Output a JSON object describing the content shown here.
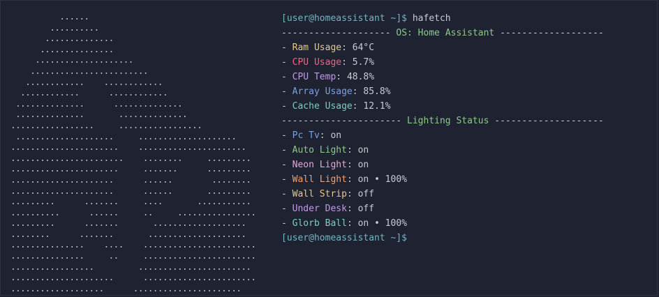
{
  "colors": {
    "background": "#1f2230",
    "text": "#c9ccd6",
    "prompt": "#6fb8c4",
    "section": "#8dc98a"
  },
  "prompt_text": "[user@homeassistant ~]$",
  "command": "hafetch",
  "ascii_art": "          ......\n        ..........\n       ..............\n      ...............\n     ....................\n    ........................\n   ............    ............\n  ............      ............\n ..............      ..............\n ..............       ..............\n.................     .................\n ....................     ....................\n......................    ......................\n.......................    ........     .........\n......................     .......      .........\n.....................      ......        ........\n.....................      ......       .........\n.........      .......     ....       ...........\n..........      ......     ..     ................\n.........      .......       ...................\n........      .......       ....................\n...............    ....    .......................\n...............     ..     .......................\n.................         .......................\n.....................      .......................\n...................      ......................",
  "section_os": {
    "left_dashes": "--------------------",
    "title": "OS: Home Assistant",
    "right_dashes": "-------------------"
  },
  "system_stats": [
    {
      "label": "Ram Usage",
      "value": "64°C",
      "color": "#e8c98f"
    },
    {
      "label": "CPU Usage",
      "value": "5.7%",
      "color": "#e06c88"
    },
    {
      "label": "CPU Temp",
      "value": "48.8%",
      "color": "#c39ae8"
    },
    {
      "label": "Array Usage",
      "value": "85.8%",
      "color": "#7aa2e0"
    },
    {
      "label": "Cache Usage",
      "value": "12.1%",
      "color": "#79cfc4"
    }
  ],
  "section_lighting": {
    "left_dashes": "----------------------",
    "title": "Lighting Status",
    "right_dashes": "--------------------"
  },
  "lights": [
    {
      "label": "Pc Tv",
      "value": "on",
      "color": "#7aa2e0"
    },
    {
      "label": "Auto Light",
      "value": "on",
      "color": "#8dc98a"
    },
    {
      "label": "Neon Light",
      "value": "on",
      "color": "#e2a8d8"
    },
    {
      "label": "Wall Light",
      "value": "on • 100%",
      "color": "#f0a070"
    },
    {
      "label": "Wall Strip",
      "value": "off",
      "color": "#e8c98f"
    },
    {
      "label": "Under Desk",
      "value": "off",
      "color": "#c39ae8"
    },
    {
      "label": "Glorb Ball",
      "value": "on • 100%",
      "color": "#79cfc4"
    }
  ]
}
